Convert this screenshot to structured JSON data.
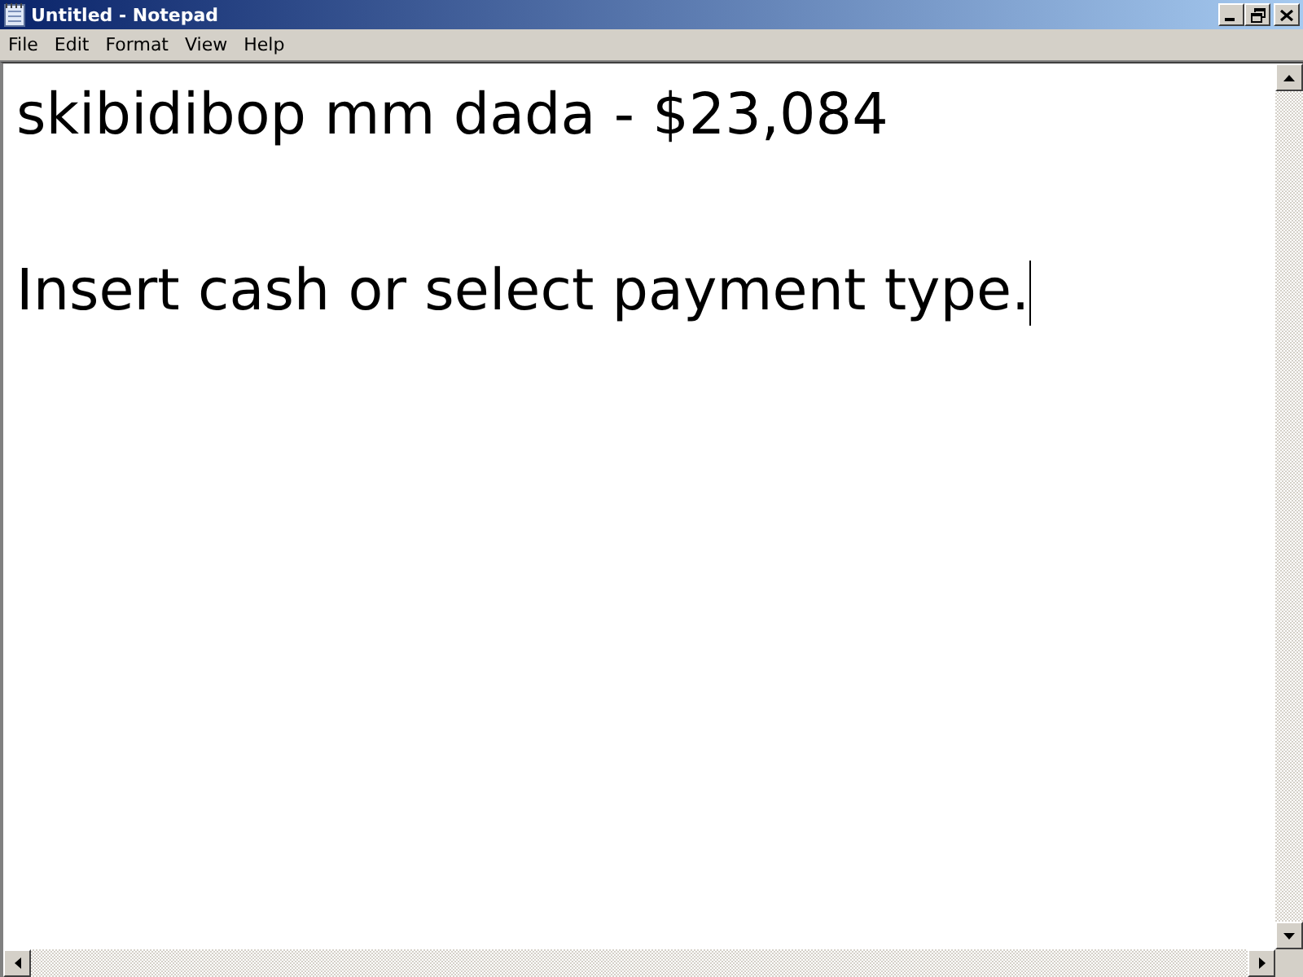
{
  "window": {
    "title": "Untitled - Notepad"
  },
  "menu": [
    "File",
    "Edit",
    "Format",
    "View",
    "Help"
  ],
  "document": {
    "lines": [
      "skibidibop mm dada - $23,084",
      "Insert cash or select payment type."
    ]
  }
}
